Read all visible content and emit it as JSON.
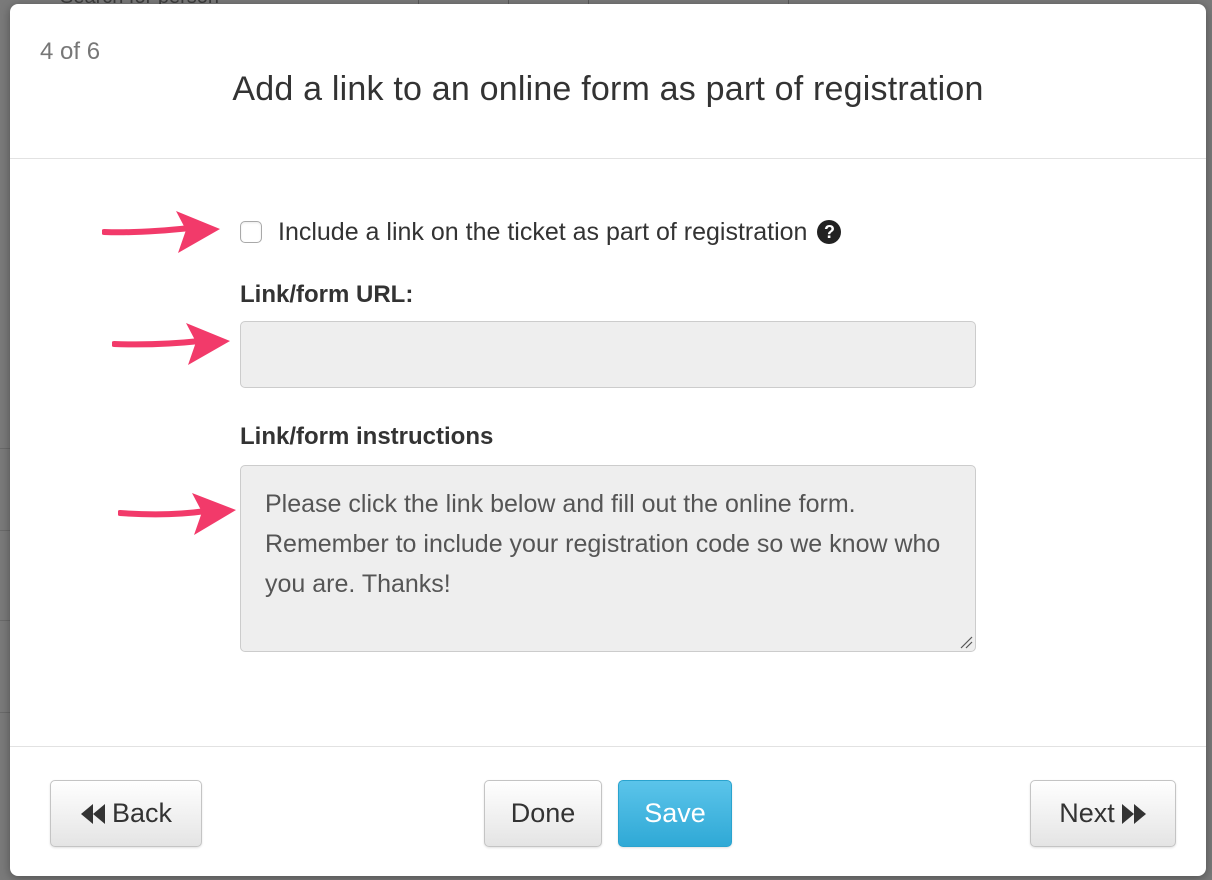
{
  "background": {
    "search_text": "Search for person"
  },
  "modal": {
    "step": "4 of 6",
    "title": "Add a link to an online form as part of registration"
  },
  "form": {
    "include_link": {
      "label": "Include a link on the ticket as part of registration",
      "checked": false,
      "help_icon": "question-circle-icon"
    },
    "url": {
      "label": "Link/form URL:",
      "value": ""
    },
    "instructions": {
      "label": "Link/form instructions",
      "value": "Please click the link below and fill out the online form. Remember to include your registration code so we know who you are. Thanks!"
    }
  },
  "footer": {
    "back_label": "Back",
    "done_label": "Done",
    "save_label": "Save",
    "next_label": "Next"
  },
  "colors": {
    "accent": "#31aad7",
    "arrow": "#f23a6a",
    "input_bg": "#eeeeee"
  },
  "icons": {
    "back": "backward-icon",
    "next": "forward-icon",
    "help": "question-circle-icon",
    "annotation": "pink-arrow-icon"
  }
}
